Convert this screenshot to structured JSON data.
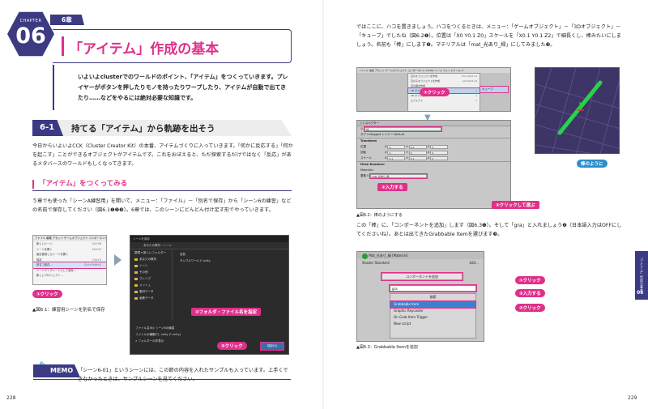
{
  "chapter": {
    "label": "CHAPTER",
    "number": "06",
    "tag": "6章"
  },
  "title": "「アイテム」作成の基本",
  "intro": "いよいよclusterでのワールドのポイント、「アイテム」をつくっていきます。プレイヤーがボタンを押したりモノを持ったりワープしたり、アイテムが自動で出てきたり……などをやるには絶対必要な知識です。",
  "section": {
    "number": "6-1",
    "title": "持てる「アイテム」から軌跡を出そう"
  },
  "section_body": "今日からいよいよCCK（Cluster Creator Kit）の本番、アイテムづくりに入っていきます。「何かに反応する」「何かを起こす」ことができるオブジェクトがアイテムです。これをおぼえると、ただ探索するだけではなく「反応」があるメタバースのワールドもしくなってきます。",
  "subsection": {
    "title": "「アイテム」をつくってみる"
  },
  "sub_body": "５章でも使った「シーンA練習用」を開いて、メニュー：「ファイル」－「別名で保存」から「シーン6の練習」などの名前で保存してください（図6.1❶❷❸）。6章では、このシーンにどんどん付け足す形でやっていきます。",
  "fig61": {
    "menubar": "ファイル 編集 アセット ゲームオブジェクト コンポーネント",
    "menu_items": [
      {
        "label": "新しいシーン",
        "key": "Ctrl+N"
      },
      {
        "label": "シーンを開く",
        "key": "Ctrl+O"
      },
      {
        "label": "最近使用したシーンを開く",
        "key": ""
      },
      {
        "label": "保存",
        "key": "Ctrl+S"
      },
      {
        "label": "別名で保存...",
        "key": "Ctrl+Shift+S"
      },
      {
        "label": "シーンテンプレートとして保存...",
        "key": ""
      },
      {
        "label": "新しいプロジェクト...",
        "key": ""
      }
    ],
    "callout1": "①クリック",
    "dialog_title": "シーンを保存",
    "address": "あなたの教材 › シーン",
    "side_items": [
      "整理 ▾   新しいフォルダー",
      "あなたの教材",
      "シーン",
      "その他",
      "プレハブ",
      "メッシュ",
      "素材データ",
      "画像データ"
    ],
    "file_items": [
      "名前",
      "サンプルワールド.unity"
    ],
    "file_name_label": "ファイル名(N):  シーン6の練習",
    "file_type_label": "ファイルの種類(T):  unity (*.unity)",
    "hide_folders": "∧ フォルダーの非表示",
    "callout2": "②フォルダ・ファイル名を指定",
    "callout3": "③クリック",
    "save_button": "保存(S)",
    "caption": "▲図6.1：練習用シーンを別名で保存"
  },
  "memo": {
    "label": "MEMO",
    "text": "「シーン6-01」というシーンには、この節の内容を入れたサンプルも入っています。上手くできなかったときは、サンプルシーンを見てください。"
  },
  "page_left": "228",
  "page_right": "229",
  "right_body1": "ではここに、ハコを置きましょう。ハコをつくるときは、メニュー：「ゲームオブジェクト」－「3Dオブジェクト」－「キューブ」でしたね（図6.2❶）。位置は「X0 Y0.1 Z0」スケールを「X0.1 Y0.1 Z2」で細長くし、棒みたいにしましょう。名前も「棒」にします❷。マテリアルは「mat_光あり_緑」にしてみました❸。",
  "fig62": {
    "menubar": "ファイル 編集 アセット ゲームオブジェクト コンポーネント Cluster ツール ウィンドウ ヘルプ",
    "menu_items": [
      {
        "label": "空のオブジェクトを作成",
        "key": "Ctrl+Shift+N"
      },
      {
        "label": "空の子オブジェクトを作成",
        "key": "Alt+Shift+N"
      },
      {
        "label": "空の親を作成",
        "key": ""
      },
      {
        "label": "3D オブジェクト",
        "key": "▸"
      },
      {
        "label": "2D オブジェクト",
        "key": "▸"
      },
      {
        "label": "エフェクト",
        "key": "▸"
      }
    ],
    "submenu": "キューブ",
    "callout1": "①クリック",
    "inspector_header": "インスペクター",
    "name_value": "棒",
    "tag_layer": "タグ Untagged   レイヤー Default",
    "transform": "Transform",
    "rows": [
      {
        "label": "位置",
        "x": "0",
        "y": "0.1",
        "z": "0"
      },
      {
        "label": "回転",
        "x": "0",
        "y": "0",
        "z": "0"
      },
      {
        "label": "スケール",
        "x": "0.1",
        "y": "0.1",
        "z": "2"
      }
    ],
    "mesh_renderer": "Mesh Renderer",
    "materials": "Materials",
    "material_value": "mat_光あり_緑",
    "callout2": "②入力する",
    "callout3": "③クリックして選ぶ",
    "scene_label": "棒のように",
    "caption": "▲図6.2：棒のようにする"
  },
  "right_body2": "この「棒」に、「コンポーネントを追加」します（図6.3❶）。そして「gra」と入れましょう❷（日本語入力はOFFにしてくださいね）。あとは出てきたGrabbable Itemを選びます❸。",
  "fig63": {
    "material_name": "Mat_光あり_緑 (Material)",
    "shader": "Shader  Standard",
    "edit": "Edit...",
    "add_component": "コンポーネントを追加",
    "search_value": "gra",
    "search_header": "検索",
    "results": [
      "Grabbable Item",
      "Graphic Raycaster",
      "On Grab Item Trigger",
      "New script"
    ],
    "callout1": "①クリック",
    "callout2": "②入力する",
    "callout3": "③クリック",
    "caption": "▲図6.3：Grabbable Itemを追加"
  },
  "side_tab": {
    "text": "「アイテム」作成の基本",
    "number": "06"
  }
}
